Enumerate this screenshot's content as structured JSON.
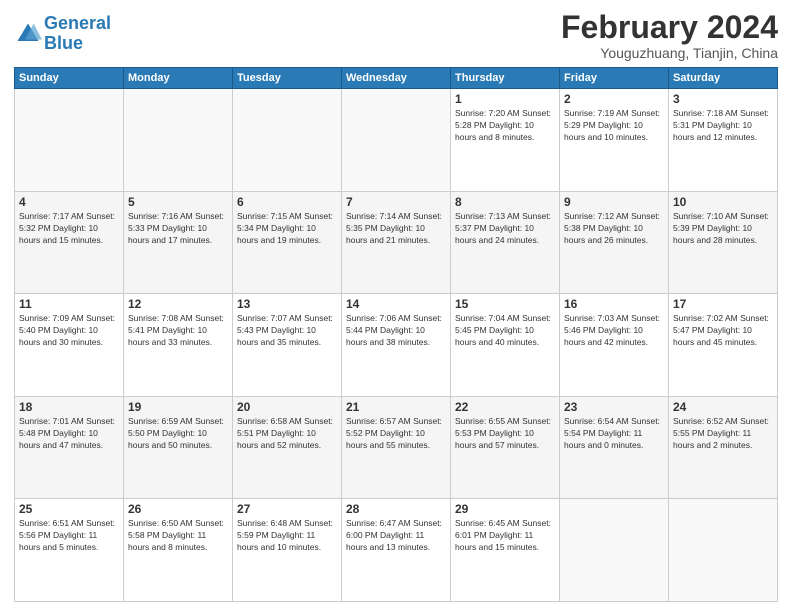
{
  "logo": {
    "line1": "General",
    "line2": "Blue"
  },
  "title": "February 2024",
  "subtitle": "Youguzhuang, Tianjin, China",
  "weekdays": [
    "Sunday",
    "Monday",
    "Tuesday",
    "Wednesday",
    "Thursday",
    "Friday",
    "Saturday"
  ],
  "weeks": [
    [
      {
        "num": "",
        "info": ""
      },
      {
        "num": "",
        "info": ""
      },
      {
        "num": "",
        "info": ""
      },
      {
        "num": "",
        "info": ""
      },
      {
        "num": "1",
        "info": "Sunrise: 7:20 AM\nSunset: 5:28 PM\nDaylight: 10 hours\nand 8 minutes."
      },
      {
        "num": "2",
        "info": "Sunrise: 7:19 AM\nSunset: 5:29 PM\nDaylight: 10 hours\nand 10 minutes."
      },
      {
        "num": "3",
        "info": "Sunrise: 7:18 AM\nSunset: 5:31 PM\nDaylight: 10 hours\nand 12 minutes."
      }
    ],
    [
      {
        "num": "4",
        "info": "Sunrise: 7:17 AM\nSunset: 5:32 PM\nDaylight: 10 hours\nand 15 minutes."
      },
      {
        "num": "5",
        "info": "Sunrise: 7:16 AM\nSunset: 5:33 PM\nDaylight: 10 hours\nand 17 minutes."
      },
      {
        "num": "6",
        "info": "Sunrise: 7:15 AM\nSunset: 5:34 PM\nDaylight: 10 hours\nand 19 minutes."
      },
      {
        "num": "7",
        "info": "Sunrise: 7:14 AM\nSunset: 5:35 PM\nDaylight: 10 hours\nand 21 minutes."
      },
      {
        "num": "8",
        "info": "Sunrise: 7:13 AM\nSunset: 5:37 PM\nDaylight: 10 hours\nand 24 minutes."
      },
      {
        "num": "9",
        "info": "Sunrise: 7:12 AM\nSunset: 5:38 PM\nDaylight: 10 hours\nand 26 minutes."
      },
      {
        "num": "10",
        "info": "Sunrise: 7:10 AM\nSunset: 5:39 PM\nDaylight: 10 hours\nand 28 minutes."
      }
    ],
    [
      {
        "num": "11",
        "info": "Sunrise: 7:09 AM\nSunset: 5:40 PM\nDaylight: 10 hours\nand 30 minutes."
      },
      {
        "num": "12",
        "info": "Sunrise: 7:08 AM\nSunset: 5:41 PM\nDaylight: 10 hours\nand 33 minutes."
      },
      {
        "num": "13",
        "info": "Sunrise: 7:07 AM\nSunset: 5:43 PM\nDaylight: 10 hours\nand 35 minutes."
      },
      {
        "num": "14",
        "info": "Sunrise: 7:06 AM\nSunset: 5:44 PM\nDaylight: 10 hours\nand 38 minutes."
      },
      {
        "num": "15",
        "info": "Sunrise: 7:04 AM\nSunset: 5:45 PM\nDaylight: 10 hours\nand 40 minutes."
      },
      {
        "num": "16",
        "info": "Sunrise: 7:03 AM\nSunset: 5:46 PM\nDaylight: 10 hours\nand 42 minutes."
      },
      {
        "num": "17",
        "info": "Sunrise: 7:02 AM\nSunset: 5:47 PM\nDaylight: 10 hours\nand 45 minutes."
      }
    ],
    [
      {
        "num": "18",
        "info": "Sunrise: 7:01 AM\nSunset: 5:48 PM\nDaylight: 10 hours\nand 47 minutes."
      },
      {
        "num": "19",
        "info": "Sunrise: 6:59 AM\nSunset: 5:50 PM\nDaylight: 10 hours\nand 50 minutes."
      },
      {
        "num": "20",
        "info": "Sunrise: 6:58 AM\nSunset: 5:51 PM\nDaylight: 10 hours\nand 52 minutes."
      },
      {
        "num": "21",
        "info": "Sunrise: 6:57 AM\nSunset: 5:52 PM\nDaylight: 10 hours\nand 55 minutes."
      },
      {
        "num": "22",
        "info": "Sunrise: 6:55 AM\nSunset: 5:53 PM\nDaylight: 10 hours\nand 57 minutes."
      },
      {
        "num": "23",
        "info": "Sunrise: 6:54 AM\nSunset: 5:54 PM\nDaylight: 11 hours\nand 0 minutes."
      },
      {
        "num": "24",
        "info": "Sunrise: 6:52 AM\nSunset: 5:55 PM\nDaylight: 11 hours\nand 2 minutes."
      }
    ],
    [
      {
        "num": "25",
        "info": "Sunrise: 6:51 AM\nSunset: 5:56 PM\nDaylight: 11 hours\nand 5 minutes."
      },
      {
        "num": "26",
        "info": "Sunrise: 6:50 AM\nSunset: 5:58 PM\nDaylight: 11 hours\nand 8 minutes."
      },
      {
        "num": "27",
        "info": "Sunrise: 6:48 AM\nSunset: 5:59 PM\nDaylight: 11 hours\nand 10 minutes."
      },
      {
        "num": "28",
        "info": "Sunrise: 6:47 AM\nSunset: 6:00 PM\nDaylight: 11 hours\nand 13 minutes."
      },
      {
        "num": "29",
        "info": "Sunrise: 6:45 AM\nSunset: 6:01 PM\nDaylight: 11 hours\nand 15 minutes."
      },
      {
        "num": "",
        "info": ""
      },
      {
        "num": "",
        "info": ""
      }
    ]
  ]
}
